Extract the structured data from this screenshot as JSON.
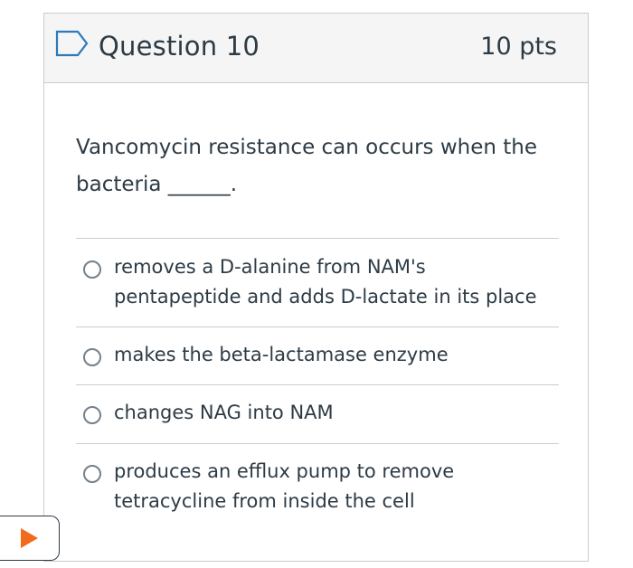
{
  "question": {
    "title": "Question 10",
    "points": "10 pts",
    "text": "Vancomycin resistance can occurs when the bacteria ______.",
    "flag_icon": "flag-outline-icon",
    "answers": [
      {
        "label": "removes a D-alanine from NAM's pentapeptide and adds D-lactate in its place"
      },
      {
        "label": "makes the beta-lactamase enzyme"
      },
      {
        "label": "changes NAG into NAM"
      },
      {
        "label": "produces an efflux pump to remove tetracycline from inside the cell"
      }
    ]
  },
  "play_button": {
    "icon": "play-icon",
    "color": "#f26b1d"
  },
  "colors": {
    "text": "#2d3b45",
    "header_bg": "#f5f5f5",
    "border": "#c7cdd1",
    "flag": "#2b7abc"
  }
}
